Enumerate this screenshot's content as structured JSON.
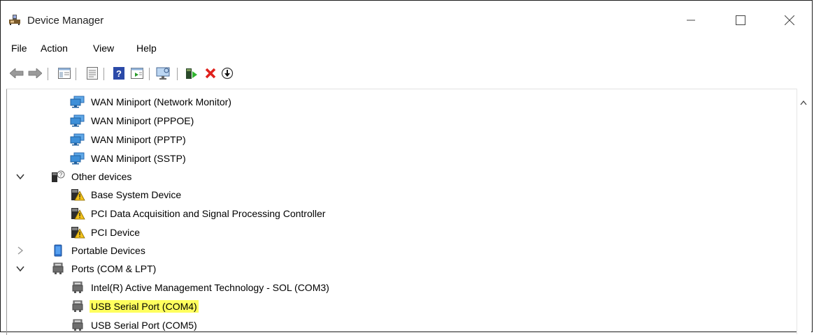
{
  "window": {
    "title": "Device Manager"
  },
  "menu": {
    "items": [
      "File",
      "Action",
      "View",
      "Help"
    ]
  },
  "tree": [
    {
      "label": "WAN Miniport (Network Monitor)",
      "icon": "network-adapter-icon"
    },
    {
      "label": "WAN Miniport (PPPOE)",
      "icon": "network-adapter-icon"
    },
    {
      "label": "WAN Miniport (PPTP)",
      "icon": "network-adapter-icon"
    },
    {
      "label": "WAN Miniport (SSTP)",
      "icon": "network-adapter-icon"
    },
    {
      "label": "Other devices",
      "icon": "unknown-device-icon",
      "expanded": true
    },
    {
      "label": "Base System Device",
      "icon": "warning-device-icon"
    },
    {
      "label": "PCI Data Acquisition and Signal Processing Controller",
      "icon": "warning-device-icon"
    },
    {
      "label": "PCI Device",
      "icon": "warning-device-icon"
    },
    {
      "label": "Portable Devices",
      "icon": "portable-device-icon",
      "expanded": false
    },
    {
      "label": "Ports (COM & LPT)",
      "icon": "port-icon",
      "expanded": true
    },
    {
      "label": "Intel(R) Active Management Technology - SOL (COM3)",
      "icon": "port-icon"
    },
    {
      "label": "USB Serial Port (COM4)",
      "icon": "port-icon",
      "highlighted": true
    },
    {
      "label": "USB Serial Port (COM5)",
      "icon": "port-icon"
    }
  ],
  "colors": {
    "highlight": "#ffff5e",
    "error_red": "#e0201c",
    "link_blue": "#1e6fd9"
  }
}
